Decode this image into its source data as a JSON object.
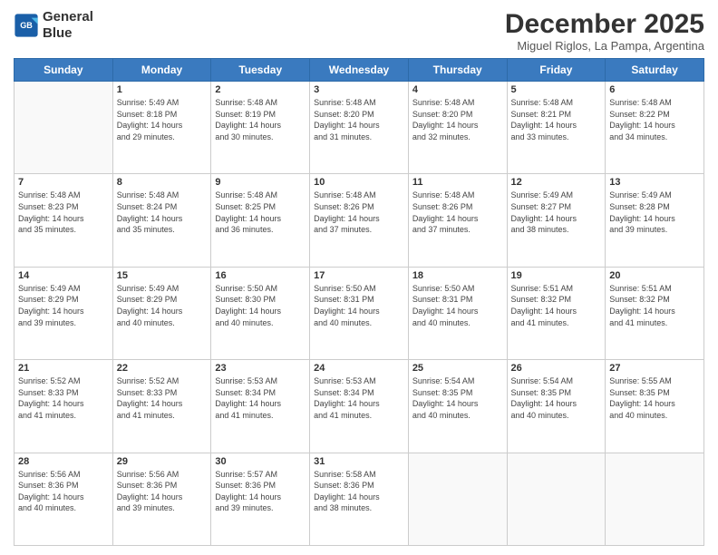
{
  "header": {
    "logo_line1": "General",
    "logo_line2": "Blue",
    "title": "December 2025",
    "location": "Miguel Riglos, La Pampa, Argentina"
  },
  "calendar": {
    "days_of_week": [
      "Sunday",
      "Monday",
      "Tuesday",
      "Wednesday",
      "Thursday",
      "Friday",
      "Saturday"
    ],
    "weeks": [
      [
        {
          "day": "",
          "info": ""
        },
        {
          "day": "1",
          "info": "Sunrise: 5:49 AM\nSunset: 8:18 PM\nDaylight: 14 hours\nand 29 minutes."
        },
        {
          "day": "2",
          "info": "Sunrise: 5:48 AM\nSunset: 8:19 PM\nDaylight: 14 hours\nand 30 minutes."
        },
        {
          "day": "3",
          "info": "Sunrise: 5:48 AM\nSunset: 8:20 PM\nDaylight: 14 hours\nand 31 minutes."
        },
        {
          "day": "4",
          "info": "Sunrise: 5:48 AM\nSunset: 8:20 PM\nDaylight: 14 hours\nand 32 minutes."
        },
        {
          "day": "5",
          "info": "Sunrise: 5:48 AM\nSunset: 8:21 PM\nDaylight: 14 hours\nand 33 minutes."
        },
        {
          "day": "6",
          "info": "Sunrise: 5:48 AM\nSunset: 8:22 PM\nDaylight: 14 hours\nand 34 minutes."
        }
      ],
      [
        {
          "day": "7",
          "info": "Sunrise: 5:48 AM\nSunset: 8:23 PM\nDaylight: 14 hours\nand 35 minutes."
        },
        {
          "day": "8",
          "info": "Sunrise: 5:48 AM\nSunset: 8:24 PM\nDaylight: 14 hours\nand 35 minutes."
        },
        {
          "day": "9",
          "info": "Sunrise: 5:48 AM\nSunset: 8:25 PM\nDaylight: 14 hours\nand 36 minutes."
        },
        {
          "day": "10",
          "info": "Sunrise: 5:48 AM\nSunset: 8:26 PM\nDaylight: 14 hours\nand 37 minutes."
        },
        {
          "day": "11",
          "info": "Sunrise: 5:48 AM\nSunset: 8:26 PM\nDaylight: 14 hours\nand 37 minutes."
        },
        {
          "day": "12",
          "info": "Sunrise: 5:49 AM\nSunset: 8:27 PM\nDaylight: 14 hours\nand 38 minutes."
        },
        {
          "day": "13",
          "info": "Sunrise: 5:49 AM\nSunset: 8:28 PM\nDaylight: 14 hours\nand 39 minutes."
        }
      ],
      [
        {
          "day": "14",
          "info": "Sunrise: 5:49 AM\nSunset: 8:29 PM\nDaylight: 14 hours\nand 39 minutes."
        },
        {
          "day": "15",
          "info": "Sunrise: 5:49 AM\nSunset: 8:29 PM\nDaylight: 14 hours\nand 40 minutes."
        },
        {
          "day": "16",
          "info": "Sunrise: 5:50 AM\nSunset: 8:30 PM\nDaylight: 14 hours\nand 40 minutes."
        },
        {
          "day": "17",
          "info": "Sunrise: 5:50 AM\nSunset: 8:31 PM\nDaylight: 14 hours\nand 40 minutes."
        },
        {
          "day": "18",
          "info": "Sunrise: 5:50 AM\nSunset: 8:31 PM\nDaylight: 14 hours\nand 40 minutes."
        },
        {
          "day": "19",
          "info": "Sunrise: 5:51 AM\nSunset: 8:32 PM\nDaylight: 14 hours\nand 41 minutes."
        },
        {
          "day": "20",
          "info": "Sunrise: 5:51 AM\nSunset: 8:32 PM\nDaylight: 14 hours\nand 41 minutes."
        }
      ],
      [
        {
          "day": "21",
          "info": "Sunrise: 5:52 AM\nSunset: 8:33 PM\nDaylight: 14 hours\nand 41 minutes."
        },
        {
          "day": "22",
          "info": "Sunrise: 5:52 AM\nSunset: 8:33 PM\nDaylight: 14 hours\nand 41 minutes."
        },
        {
          "day": "23",
          "info": "Sunrise: 5:53 AM\nSunset: 8:34 PM\nDaylight: 14 hours\nand 41 minutes."
        },
        {
          "day": "24",
          "info": "Sunrise: 5:53 AM\nSunset: 8:34 PM\nDaylight: 14 hours\nand 41 minutes."
        },
        {
          "day": "25",
          "info": "Sunrise: 5:54 AM\nSunset: 8:35 PM\nDaylight: 14 hours\nand 40 minutes."
        },
        {
          "day": "26",
          "info": "Sunrise: 5:54 AM\nSunset: 8:35 PM\nDaylight: 14 hours\nand 40 minutes."
        },
        {
          "day": "27",
          "info": "Sunrise: 5:55 AM\nSunset: 8:35 PM\nDaylight: 14 hours\nand 40 minutes."
        }
      ],
      [
        {
          "day": "28",
          "info": "Sunrise: 5:56 AM\nSunset: 8:36 PM\nDaylight: 14 hours\nand 40 minutes."
        },
        {
          "day": "29",
          "info": "Sunrise: 5:56 AM\nSunset: 8:36 PM\nDaylight: 14 hours\nand 39 minutes."
        },
        {
          "day": "30",
          "info": "Sunrise: 5:57 AM\nSunset: 8:36 PM\nDaylight: 14 hours\nand 39 minutes."
        },
        {
          "day": "31",
          "info": "Sunrise: 5:58 AM\nSunset: 8:36 PM\nDaylight: 14 hours\nand 38 minutes."
        },
        {
          "day": "",
          "info": ""
        },
        {
          "day": "",
          "info": ""
        },
        {
          "day": "",
          "info": ""
        }
      ]
    ]
  }
}
